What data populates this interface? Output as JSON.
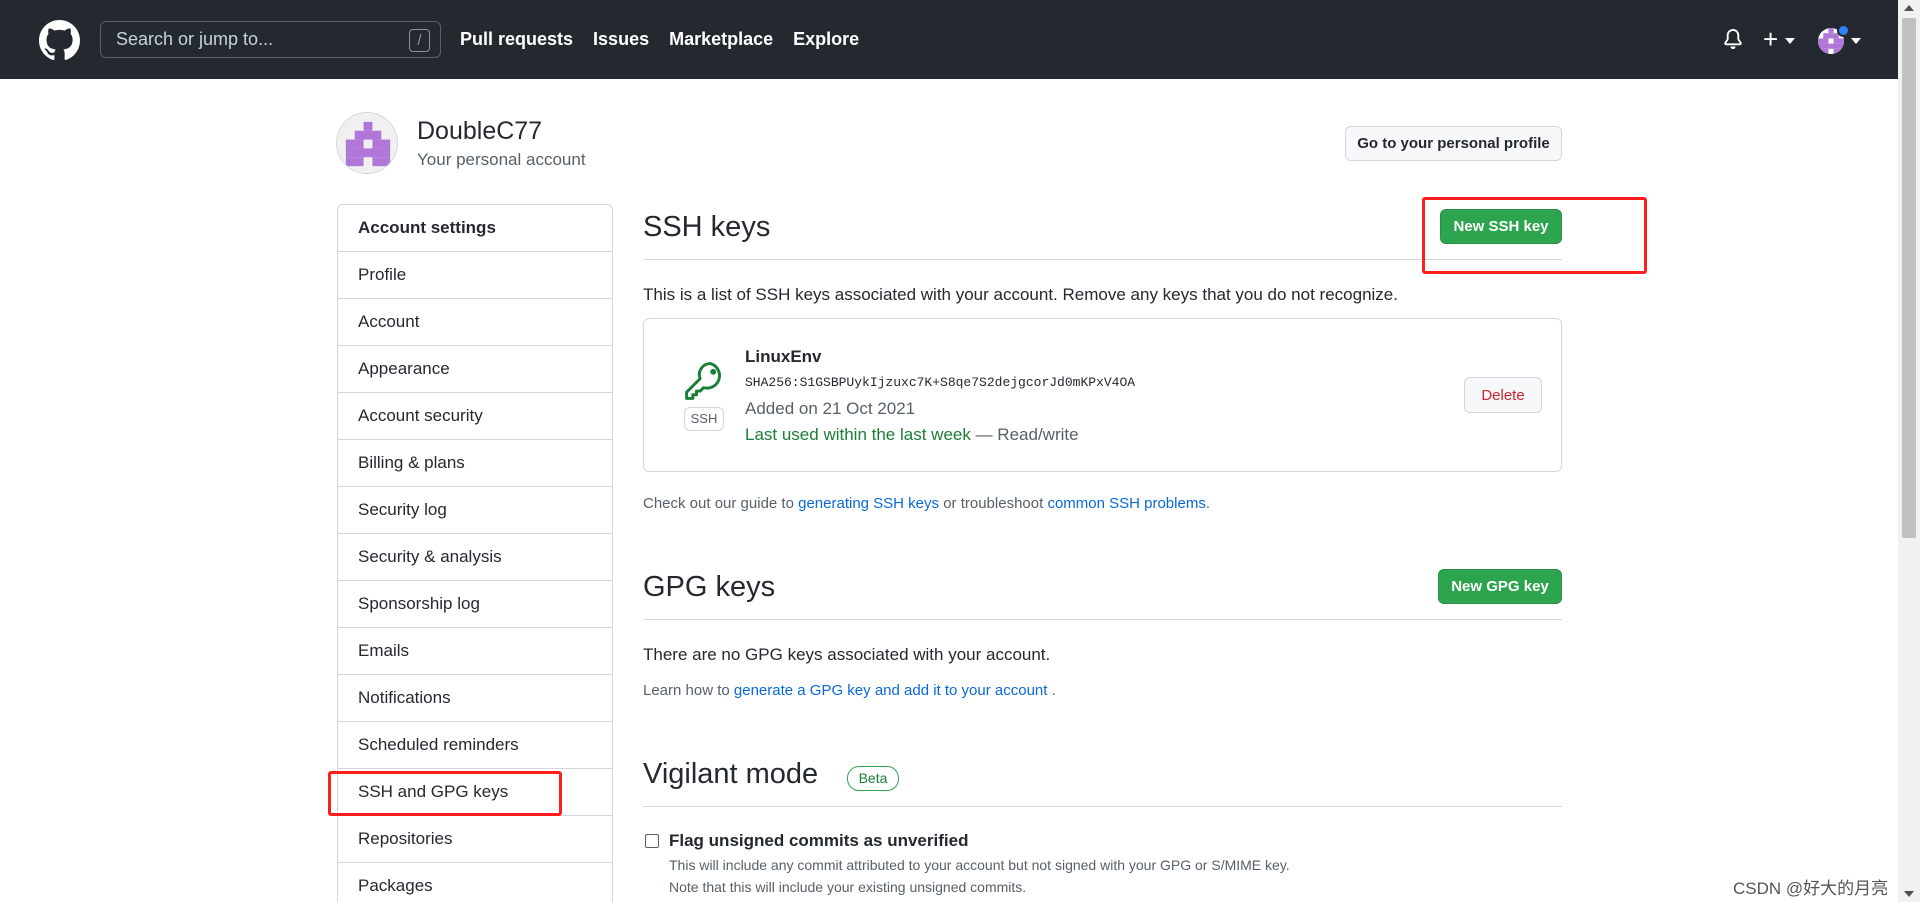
{
  "header": {
    "search_placeholder": "Search or jump to...",
    "slash_hint": "/",
    "nav": [
      "Pull requests",
      "Issues",
      "Marketplace",
      "Explore"
    ]
  },
  "account": {
    "name": "DoubleC77",
    "subtitle": "Your personal account",
    "profile_button": "Go to your personal profile"
  },
  "sidebar": {
    "heading": "Account settings",
    "items": [
      "Profile",
      "Account",
      "Appearance",
      "Account security",
      "Billing & plans",
      "Security log",
      "Security & analysis",
      "Sponsorship log",
      "Emails",
      "Notifications",
      "Scheduled reminders",
      "SSH and GPG keys",
      "Repositories",
      "Packages"
    ]
  },
  "ssh": {
    "title": "SSH keys",
    "new_button": "New SSH key",
    "description": "This is a list of SSH keys associated with your account. Remove any keys that you do not recognize.",
    "key": {
      "badge": "SSH",
      "name": "LinuxEnv",
      "fingerprint": "SHA256:S1GSBPUykIjzuxc7K+S8qe7S2dejgcorJd0mKPxV4OA",
      "added": "Added on 21 Oct 2021",
      "last_used": "Last used within the last week",
      "access": " — Read/write",
      "delete_button": "Delete"
    },
    "note_prefix": "Check out our guide to ",
    "note_link1": "generating SSH keys",
    "note_mid": " or troubleshoot ",
    "note_link2": "common SSH problems",
    "note_suffix": "."
  },
  "gpg": {
    "title": "GPG keys",
    "new_button": "New GPG key",
    "empty": "There are no GPG keys associated with your account.",
    "learn_prefix": "Learn how to ",
    "learn_link": "generate a GPG key and add it to your account",
    "learn_suffix": " ."
  },
  "vigilant": {
    "title": "Vigilant mode",
    "badge": "Beta",
    "checkbox_label": "Flag unsigned commits as unverified",
    "help1": "This will include any commit attributed to your account but not signed with your GPG or S/MIME key.",
    "help2": "Note that this will include your existing unsigned commits."
  },
  "watermark": "CSDN @好大的月亮",
  "colors": {
    "header_bg": "#24292f",
    "primary_green": "#2da44e",
    "link_blue": "#0969da",
    "danger_red": "#cf222e",
    "highlight_red": "#ff1e1e"
  }
}
